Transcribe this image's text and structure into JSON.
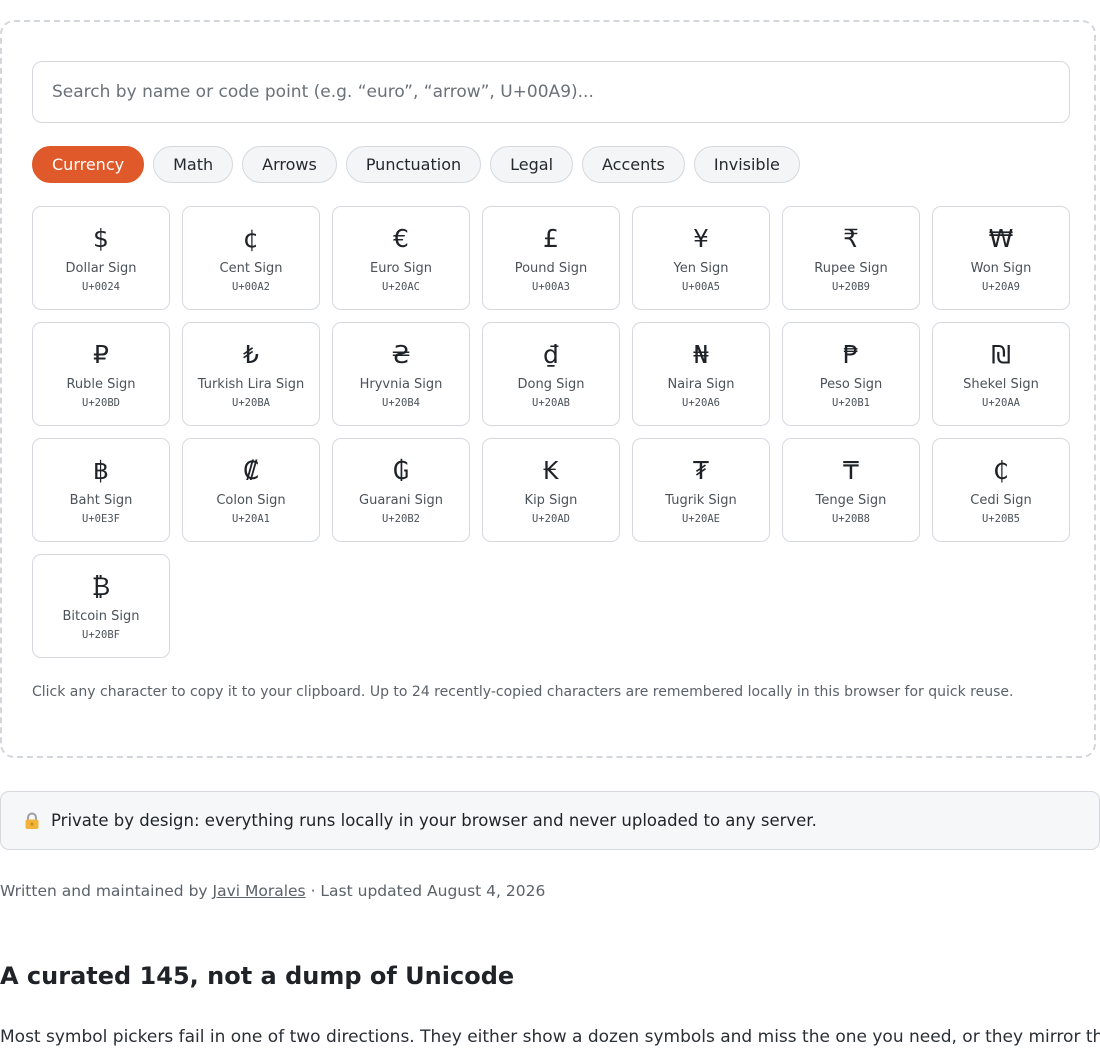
{
  "search": {
    "placeholder": "Search by name or code point (e.g. “euro”, “arrow”, U+00A9)..."
  },
  "tabs": [
    {
      "label": "Currency",
      "active": true
    },
    {
      "label": "Math",
      "active": false
    },
    {
      "label": "Arrows",
      "active": false
    },
    {
      "label": "Punctuation",
      "active": false
    },
    {
      "label": "Legal",
      "active": false
    },
    {
      "label": "Accents",
      "active": false
    },
    {
      "label": "Invisible",
      "active": false
    }
  ],
  "characters": [
    {
      "glyph": "$",
      "name": "Dollar Sign",
      "code": "U+0024"
    },
    {
      "glyph": "¢",
      "name": "Cent Sign",
      "code": "U+00A2"
    },
    {
      "glyph": "€",
      "name": "Euro Sign",
      "code": "U+20AC"
    },
    {
      "glyph": "£",
      "name": "Pound Sign",
      "code": "U+00A3"
    },
    {
      "glyph": "¥",
      "name": "Yen Sign",
      "code": "U+00A5"
    },
    {
      "glyph": "₹",
      "name": "Rupee Sign",
      "code": "U+20B9"
    },
    {
      "glyph": "₩",
      "name": "Won Sign",
      "code": "U+20A9"
    },
    {
      "glyph": "₽",
      "name": "Ruble Sign",
      "code": "U+20BD"
    },
    {
      "glyph": "₺",
      "name": "Turkish Lira Sign",
      "code": "U+20BA"
    },
    {
      "glyph": "₴",
      "name": "Hryvnia Sign",
      "code": "U+20B4"
    },
    {
      "glyph": "₫",
      "name": "Dong Sign",
      "code": "U+20AB"
    },
    {
      "glyph": "₦",
      "name": "Naira Sign",
      "code": "U+20A6"
    },
    {
      "glyph": "₱",
      "name": "Peso Sign",
      "code": "U+20B1"
    },
    {
      "glyph": "₪",
      "name": "Shekel Sign",
      "code": "U+20AA"
    },
    {
      "glyph": "฿",
      "name": "Baht Sign",
      "code": "U+0E3F"
    },
    {
      "glyph": "₡",
      "name": "Colon Sign",
      "code": "U+20A1"
    },
    {
      "glyph": "₲",
      "name": "Guarani Sign",
      "code": "U+20B2"
    },
    {
      "glyph": "₭",
      "name": "Kip Sign",
      "code": "U+20AD"
    },
    {
      "glyph": "₮",
      "name": "Tugrik Sign",
      "code": "U+20AE"
    },
    {
      "glyph": "₸",
      "name": "Tenge Sign",
      "code": "U+20B8"
    },
    {
      "glyph": "₵",
      "name": "Cedi Sign",
      "code": "U+20B5"
    },
    {
      "glyph": "₿",
      "name": "Bitcoin Sign",
      "code": "U+20BF"
    }
  ],
  "hint": "Click any character to copy it to your clipboard. Up to 24 recently-copied characters are remembered locally in this browser for quick reuse.",
  "privacy": {
    "icon": "lock-icon",
    "text": "Private by design: everything runs locally in your browser and never uploaded to any server."
  },
  "byline": {
    "prefix": "Written and maintained by ",
    "author": "Javi Morales",
    "separator": " · ",
    "updated": "Last updated August 4, 2026"
  },
  "article": {
    "heading": "A curated 145, not a dump of Unicode",
    "paragraph": "Most symbol pickers fail in one of two directions. They either show a dozen symbols and miss the one you need, or they mirror the"
  },
  "colors": {
    "accent": "#e0592a",
    "border": "#d5d9de",
    "muted_text": "#5b626a"
  }
}
